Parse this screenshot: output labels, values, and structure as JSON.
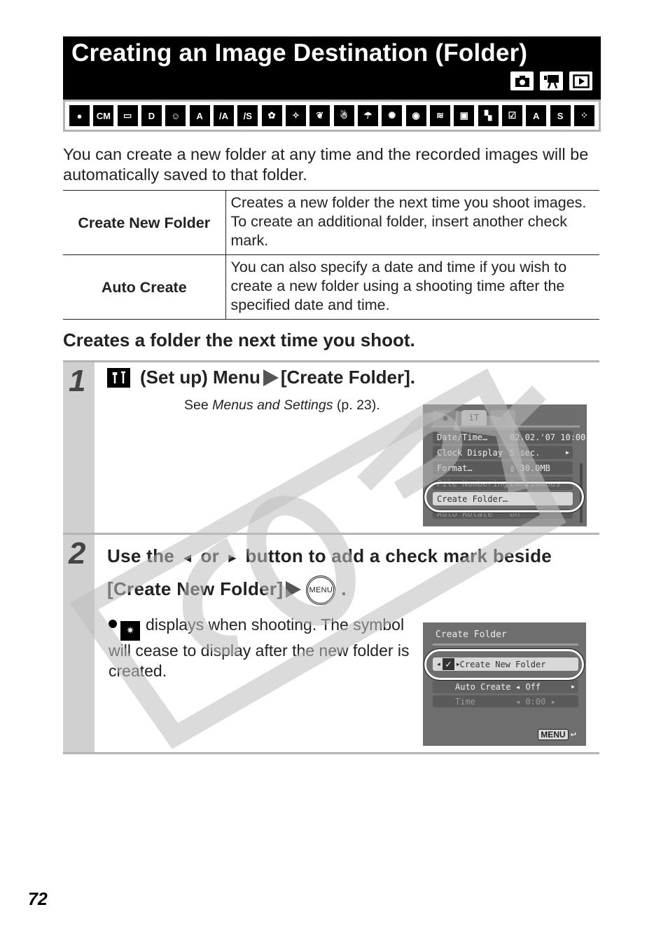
{
  "title": {
    "text": "Creating an Image Destination (Folder)",
    "mode_icons": [
      "camera-icon",
      "movie-icon",
      "playback-icon"
    ]
  },
  "scene_modes": [
    "auto-mode-icon",
    "camera-m-mode-icon",
    "stitch-assist-icon",
    "digital-macro-icon",
    "portrait-icon",
    "night-snapshot-icon",
    "color-accent-icon",
    "color-swap-icon",
    "kids-pets-icon",
    "indoor-party-icon",
    "foliage-icon",
    "snow-icon",
    "beach-icon",
    "fireworks-icon",
    "aquarium-icon",
    "underwater-icon",
    "movie-standard-icon",
    "movie-fast-frame-icon",
    "movie-compact-icon",
    "movie-color-accent-icon",
    "movie-color-swap-icon",
    "movie-time-lapse-icon"
  ],
  "intro": "You can create a new folder at any time and the recorded images will be automatically saved to that folder.",
  "options": [
    {
      "name": "Create New Folder",
      "description": "Creates a new folder the next time you shoot images. To create an additional folder, insert another check mark."
    },
    {
      "name": "Auto Create",
      "description": "You can also specify a date and time if you wish to create a new folder using a shooting time after the specified date and time."
    }
  ],
  "section_heading": "Creates a folder the next time you shoot.",
  "step1": {
    "number": "1",
    "title_prefix": "(Set up) Menu",
    "title_suffix": "[Create Folder].",
    "sub_see": "See ",
    "sub_link": "Menus and Settings",
    "sub_page": " (p. 23).",
    "screen": {
      "tabs": [
        "rec-tab-icon",
        "setup-tab-icon",
        "my-camera-tab-icon"
      ],
      "rows": [
        {
          "label": "Date/Time…",
          "value": "02.02.'07 10:00"
        },
        {
          "label": "Clock Display",
          "value": "5 sec."
        },
        {
          "label": "Format…",
          "value": "30.0MB"
        },
        {
          "label": "File Numbering",
          "value": "Continuous"
        },
        {
          "label": "Create Folder…",
          "value": ""
        },
        {
          "label": "Auto Rotate",
          "value": "On"
        }
      ]
    }
  },
  "step2": {
    "number": "2",
    "title_part1": "Use the",
    "left_arrow": "left-button-icon",
    "title_or": "or",
    "right_arrow": "right-button-icon",
    "title_part2": "button to add a check mark beside [Create New Folder]",
    "menu_label": "MENU",
    "title_end": ".",
    "bullet": "displays when shooting. The symbol will cease to display after the new folder is created.",
    "screen": {
      "title": "Create Folder",
      "rows": [
        {
          "label": "Create New Folder",
          "value": "",
          "checked": true
        },
        {
          "label": "Auto Create",
          "value": "Off"
        },
        {
          "label": "Time",
          "value": "0:00"
        }
      ],
      "menu_button": "MENU"
    }
  },
  "watermark": "COPY",
  "page_number": "72"
}
